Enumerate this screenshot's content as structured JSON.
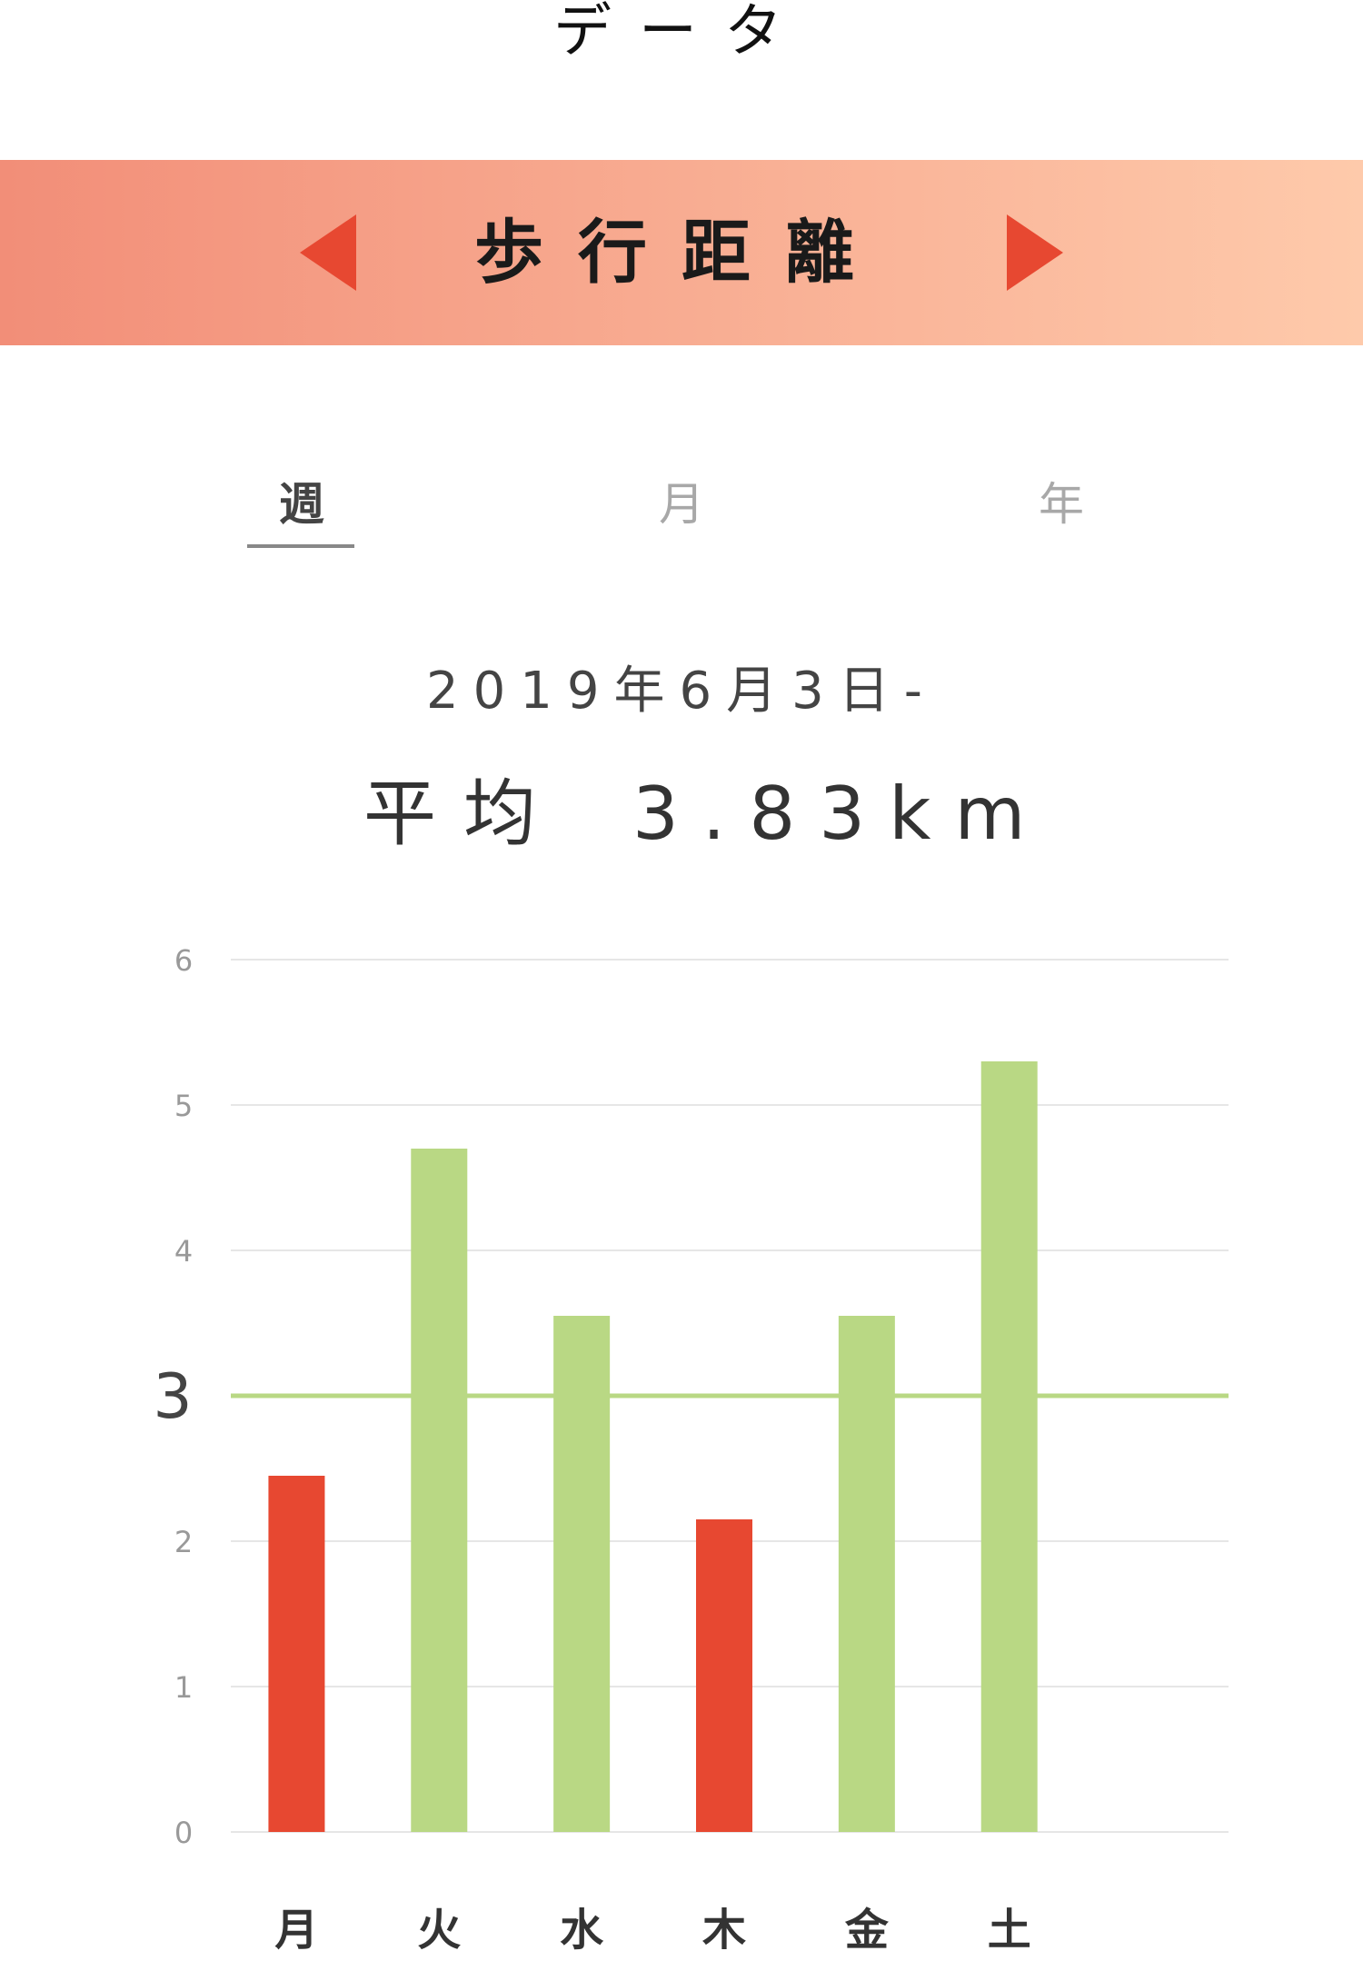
{
  "header": {
    "title": "データ"
  },
  "metric_bar": {
    "title": "歩行距離",
    "prev_icon": "triangle-left-icon",
    "next_icon": "triangle-right-icon",
    "colors": {
      "gradient_start": "#f28e78",
      "gradient_end": "#fecaab",
      "arrow": "#e74831"
    }
  },
  "tabs": [
    {
      "label": "週",
      "active": true
    },
    {
      "label": "月",
      "active": false
    },
    {
      "label": "年",
      "active": false
    }
  ],
  "summary": {
    "date_range": "2019年6月3日-",
    "average_label": "平均",
    "average_value": "3.83km"
  },
  "chart_data": {
    "type": "bar",
    "categories": [
      "月",
      "火",
      "水",
      "木",
      "金",
      "土",
      ""
    ],
    "values": [
      2.45,
      4.7,
      3.55,
      2.15,
      3.55,
      5.3,
      null
    ],
    "ylim": [
      0,
      6
    ],
    "yticks": [
      0,
      1,
      2,
      4,
      5,
      6
    ],
    "threshold": {
      "value": 3,
      "label": "3",
      "color": "#b9d884"
    },
    "grid": true,
    "colors": {
      "above_threshold": "#b9d884",
      "below_threshold": "#e74831",
      "grid": "#e6e6e6"
    }
  }
}
